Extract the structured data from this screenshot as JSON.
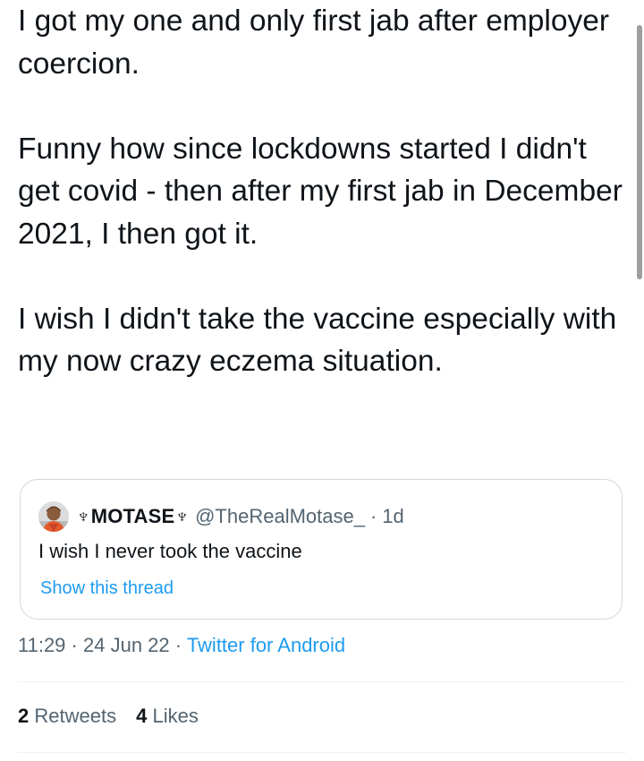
{
  "tweet": {
    "paragraphs": [
      "I got my one and only first jab after employer coercion.",
      "Funny how since lockdowns started I didn't get covid - then after my first jab in December 2021, I then got it.",
      "I wish I didn't take the vaccine especially with my now crazy eczema situation."
    ]
  },
  "quoted_tweet": {
    "display_name": "♆MOTASE♆",
    "handle": "@TheRealMotase_",
    "separator": "·",
    "time_ago": "1d",
    "text": "I wish I never took the vaccine",
    "thread_link": "Show this thread",
    "avatar_icon": "profile-photo"
  },
  "meta": {
    "time": "11:29",
    "separator": "·",
    "date": "24 Jun 22",
    "source": "Twitter for Android"
  },
  "stats": {
    "retweets_count": "2",
    "retweets_label": "Retweets",
    "likes_count": "4",
    "likes_label": "Likes"
  },
  "colors": {
    "text": "#0f1419",
    "secondary": "#536471",
    "link": "#1d9bf0",
    "border": "#cfd9de",
    "divider": "#eff3f4"
  }
}
